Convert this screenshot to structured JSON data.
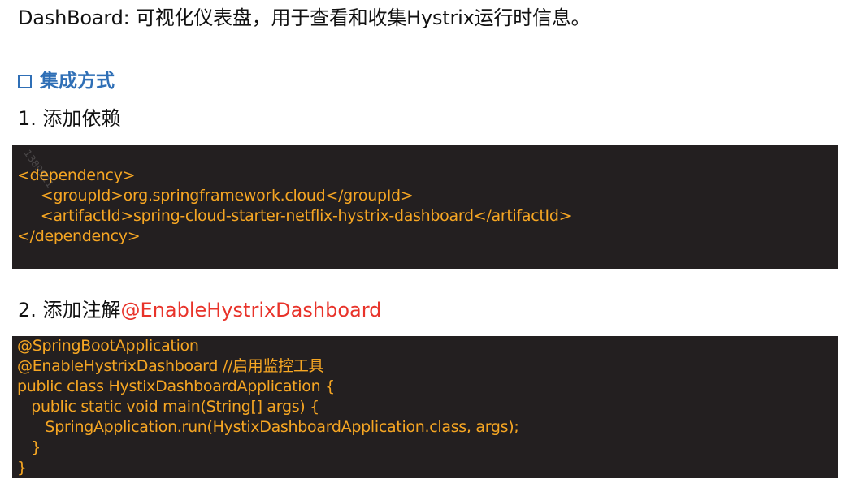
{
  "intro": {
    "term": "DashBoard",
    "text": ": 可视化仪表盘，用于查看和收集Hystrix运行时信息。"
  },
  "section": {
    "heading": "集成方式",
    "icon": "checkbox-square-icon",
    "color": "#2f6fb6"
  },
  "steps": [
    {
      "label": "1. 添加依赖"
    },
    {
      "label": "2. 添加注解",
      "annotation": "@EnableHystrixDashboard"
    }
  ],
  "code_blocks": [
    {
      "lines": [
        "<dependency>",
        "     <groupId>org.springframework.cloud</groupId>",
        "     <artifactId>spring-cloud-starter-netflix-hystrix-dashboard</artifactId>",
        "</dependency>"
      ]
    },
    {
      "lines": [
        "@SpringBootApplication",
        "@EnableHystrixDashboard //启用监控工具",
        "public class HystixDashboardApplication {",
        "   public static void main(String[] args) {",
        "      SpringApplication.run(HystixDashboardApplication.class, args);",
        "   }",
        "}"
      ]
    }
  ],
  "watermark": "1389921",
  "colors": {
    "code_bg": "#231f20",
    "code_text": "#f6a623",
    "annotation": "#e8332a"
  }
}
